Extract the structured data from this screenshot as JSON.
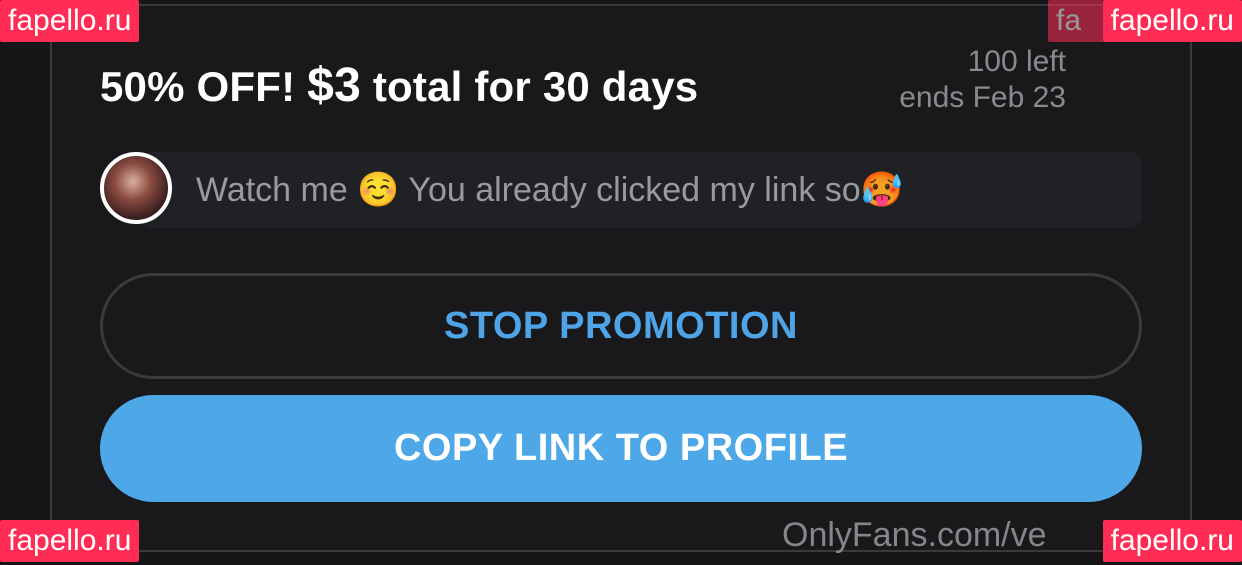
{
  "promo": {
    "title_prefix": "50% OFF! ",
    "price": "$3",
    "title_suffix": " total for 30 days",
    "remaining": "100 left",
    "ends": "ends Feb 23"
  },
  "message": {
    "text": "Watch me ☺️ You already clicked my link so🥵"
  },
  "buttons": {
    "stop_label": "STOP PROMOTION",
    "copy_label": "COPY LINK TO PROFILE"
  },
  "watermark": {
    "text": "fapello.ru",
    "ghost_text": "fa",
    "site": "OnlyFans.com/ve"
  },
  "colors": {
    "accent": "#4ea8e8",
    "watermark_bg": "#ff2d55",
    "background": "#19191b"
  }
}
